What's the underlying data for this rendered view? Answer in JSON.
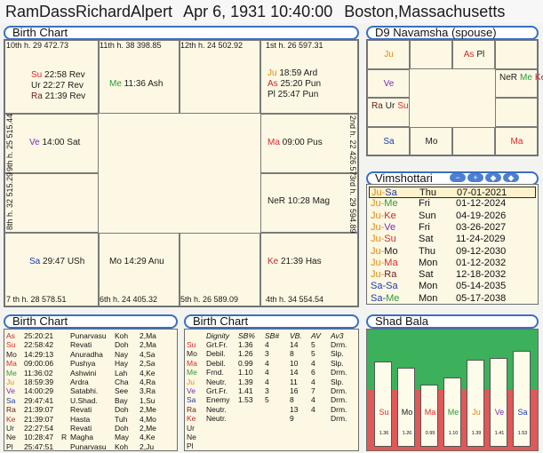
{
  "header": {
    "name": "RamDassRichardAlpert",
    "datetime": "Apr 6, 1931 10:40:00",
    "place": "Boston,Massachusetts"
  },
  "titles": {
    "birth_chart": "Birth Chart",
    "navamsha": "D9 Navamsha  (spouse)",
    "vimshottari": "Vimshottari",
    "birth_chart_2": "Birth Chart",
    "birth_chart_3": "Birth Chart",
    "shad_bala": "Shad Bala"
  },
  "colors": {
    "su": "#d92a2a",
    "mo": "#1a1a1a",
    "ma": "#d92a2a",
    "me": "#2a9a3a",
    "ju": "#e08a10",
    "ve": "#7a2ab8",
    "sa": "#1a3ab0",
    "ra": "#6a1a1a",
    "ke": "#c02a2a",
    "ur": "#1a1a1a",
    "ne": "#1a1a1a",
    "pl": "#1a1a1a",
    "as": "#c02a2a",
    "accent": "#3a6fc4"
  },
  "house_labels": {
    "h10": "10th h.  29  472.73",
    "h11": "11th h.  38  398.85",
    "h12": "12th h.  24  502.92",
    "h1": "1st h.  26  597.31",
    "h9": "9th h.  25  515.44",
    "h8": "8th h.  32  515.29",
    "h2": "2nd h.  22  426.57",
    "h3": "3rd h.  29  594.89",
    "h7": "7 th h.  28  578.51",
    "h6": "6th h.  24  405.32",
    "h5": "5th h.  26  589.09",
    "h4": "4th h.  34  554.54"
  },
  "main_planets": {
    "h10": [
      {
        "p": "Su",
        "t": " 22:58 Rev"
      },
      {
        "p": "Ur",
        "t": " 22:27 Rev"
      },
      {
        "p": "Ra",
        "t": " 21:39 Rev"
      }
    ],
    "h11": [
      {
        "p": "Me",
        "t": " 11:36 Ash"
      }
    ],
    "h1": [
      {
        "p": "Ju",
        "t": " 18:59 Ard"
      },
      {
        "p": "As",
        "t": " 25:20 Pun"
      },
      {
        "p": "Pl",
        "t": " 25:47 Pun"
      }
    ],
    "h9": [
      {
        "p": "Ve",
        "t": " 14:00 Sat"
      }
    ],
    "h2": [
      {
        "p": "Ma",
        "t": " 09:00 Pus"
      }
    ],
    "h3": [
      {
        "p": "NeR",
        "t": " 10:28 Mag"
      }
    ],
    "h7": [
      {
        "p": "Sa",
        "t": " 29:47 USh"
      }
    ],
    "h6": [
      {
        "p": "Mo",
        "t": " 14:29 Anu"
      }
    ],
    "h4": [
      {
        "p": "Ke",
        "t": " 21:39 Has"
      }
    ]
  },
  "navamsha": {
    "c00": [
      "Ju"
    ],
    "c02": [
      "As",
      "Pl"
    ],
    "c10": [
      "Ve"
    ],
    "c13": [
      "NeR",
      "Me",
      "Ke"
    ],
    "c20": [
      "Ra",
      "Ur",
      "Su"
    ],
    "c30": [
      "Sa"
    ],
    "c31": [
      "Mo"
    ],
    "c33": [
      "Ma"
    ]
  },
  "vimshottari_rows": [
    {
      "d1": "Ju",
      "d2": "Sa",
      "day": "Thu",
      "date": "07-01-2021",
      "selected": true
    },
    {
      "d1": "Ju",
      "d2": "Me",
      "day": "Fri",
      "date": "01-12-2024"
    },
    {
      "d1": "Ju",
      "d2": "Ke",
      "day": "Sun",
      "date": "04-19-2026"
    },
    {
      "d1": "Ju",
      "d2": "Ve",
      "day": "Fri",
      "date": "03-26-2027"
    },
    {
      "d1": "Ju",
      "d2": "Su",
      "day": "Sat",
      "date": "11-24-2029"
    },
    {
      "d1": "Ju",
      "d2": "Mo",
      "day": "Thu",
      "date": "09-12-2030"
    },
    {
      "d1": "Ju",
      "d2": "Ma",
      "day": "Mon",
      "date": "01-12-2032"
    },
    {
      "d1": "Ju",
      "d2": "Ra",
      "day": "Sat",
      "date": "12-18-2032"
    },
    {
      "d1": "Sa",
      "d2": "Sa",
      "day": "Mon",
      "date": "05-14-2035"
    },
    {
      "d1": "Sa",
      "d2": "Me",
      "day": "Mon",
      "date": "05-17-2038"
    }
  ],
  "vim_buttons": [
    "−",
    "+",
    "◆",
    "◆"
  ],
  "table1_rows": [
    [
      "As",
      "25:20:21",
      "",
      "Punarvasu",
      "Koh",
      "2,Ma"
    ],
    [
      "Su",
      "22:58:42",
      "",
      "Revati",
      "Doh",
      "2,Ma"
    ],
    [
      "Mo",
      "14:29:13",
      "",
      "Anuradha",
      "Nay",
      "4,Sa"
    ],
    [
      "Ma",
      "09:00:06",
      "",
      "Pushya",
      "Hay",
      "2,Sa"
    ],
    [
      "Me",
      "11:36:02",
      "",
      "Ashwini",
      "Lah",
      "4,Ke"
    ],
    [
      "Ju",
      "18:59:39",
      "",
      "Ardra",
      "Cha",
      "4,Ra"
    ],
    [
      "Ve",
      "14:00:29",
      "",
      "Satabhi.",
      "See",
      "3,Ra"
    ],
    [
      "Sa",
      "29:47:41",
      "",
      "U.Shad.",
      "Bay",
      "1,Su"
    ],
    [
      "Ra",
      "21:39:07",
      "",
      "Revati",
      "Doh",
      "2,Me"
    ],
    [
      "Ke",
      "21:39:07",
      "",
      "Hasta",
      "Tuh",
      "4,Mo"
    ],
    [
      "Ur",
      "22:27:54",
      "",
      "Revati",
      "Doh",
      "2,Me"
    ],
    [
      "Ne",
      "10:28:47",
      "R",
      "Magha",
      "May",
      "4,Ke"
    ],
    [
      "Pl",
      "25:47:51",
      "",
      "Punarvasu",
      "Koh",
      "2,Ju"
    ]
  ],
  "table2_header": [
    "",
    "Dignity",
    "SB%",
    "SB#",
    "VB.",
    "AV",
    "Av3"
  ],
  "table2_rows": [
    [
      "Su",
      "Grt.Fr.",
      "1.36",
      "4",
      "14",
      "5",
      "Drm."
    ],
    [
      "Mo",
      "Debil.",
      "1.26",
      "3",
      "8",
      "5",
      "Slp."
    ],
    [
      "Ma",
      "Debil.",
      "0.99",
      "4",
      "10",
      "4",
      "Slp."
    ],
    [
      "Me",
      "Frnd.",
      "1.10",
      "4",
      "14",
      "6",
      "Drm."
    ],
    [
      "Ju",
      "Neutr.",
      "1.39",
      "4",
      "11",
      "4",
      "Slp."
    ],
    [
      "Ve",
      "Grt.Fr.",
      "1.41",
      "3",
      "16",
      "7",
      "Drm."
    ],
    [
      "Sa",
      "Enemy",
      "1.53",
      "5",
      "8",
      "4",
      "Drm."
    ],
    [
      "Ra",
      "Neutr.",
      "",
      "",
      "13",
      "4",
      "Drm."
    ],
    [
      "Ke",
      "Neutr.",
      "",
      "",
      "9",
      "",
      "Drm."
    ],
    [
      "Ur",
      "",
      "",
      "",
      "",
      "",
      ""
    ],
    [
      "Ne",
      "",
      "",
      "",
      "",
      "",
      ""
    ],
    [
      "Pl",
      "",
      "",
      "",
      "",
      "",
      ""
    ]
  ],
  "shad_bala": [
    {
      "p": "Su",
      "v": "1.36",
      "n": 1.36
    },
    {
      "p": "Mo",
      "v": "1.26",
      "n": 1.26
    },
    {
      "p": "Ma",
      "v": "0.99",
      "n": 0.99
    },
    {
      "p": "Me",
      "v": "1.10",
      "n": 1.1
    },
    {
      "p": "Ju",
      "v": "1.39",
      "n": 1.39
    },
    {
      "p": "Ve",
      "v": "1.41",
      "n": 1.41
    },
    {
      "p": "Sa",
      "v": "1.53",
      "n": 1.53
    }
  ]
}
